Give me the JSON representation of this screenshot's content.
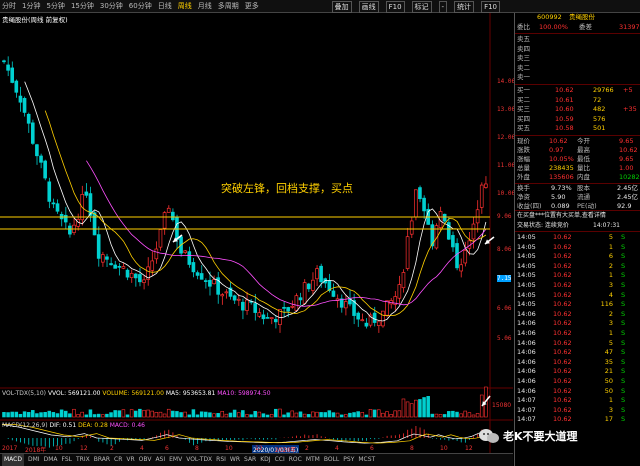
{
  "toolbar": {
    "tabs": [
      "分时",
      "1分钟",
      "5分钟",
      "15分钟",
      "30分钟",
      "60分钟",
      "日线",
      "周线",
      "月线",
      "多周期",
      "更多"
    ],
    "active_tab": "周线",
    "tools": [
      "叠加",
      "画线",
      "F10",
      "标记",
      "-",
      "统计",
      "F10"
    ]
  },
  "chart": {
    "title": "贵绳股份(周线 前复权)",
    "annotation": "突破左锋，回档支撑，买点",
    "price_labels": [
      "14.06",
      "13.06",
      "12.06",
      "11.06",
      "10.06",
      "9.06",
      "8.06",
      "7.15",
      "6.06",
      "5.06",
      "4.06",
      "3.06",
      "2.06"
    ],
    "date_labels": [
      "2017",
      "2018年",
      "10",
      "12",
      "2",
      "4",
      "6",
      "8",
      "10",
      "12",
      "2020年",
      "2",
      "4",
      "6",
      "8",
      "10",
      "12"
    ],
    "volume_header": {
      "label": "VOL-TDX(5,10)",
      "vvol": "VVOL: 569121.00",
      "volume": "VOLUME: 569121.00",
      "ma5": "MA5: 953653.81",
      "ma10": "MA10: 598974.50"
    },
    "volume_axis_label": "15080",
    "macd_header": {
      "label": "MACD(12,26,9)",
      "dif": "DIF: 0.51",
      "dea": "DEA: 0.28",
      "macd": "MACD: 0.46"
    },
    "date_marker": "2020/01/03(五)",
    "colors": {
      "up": "#ff3030",
      "down": "#00d0d0",
      "vol_up": "#ff3030",
      "vol_down": "#00d0d0"
    }
  },
  "bottom_tabs": [
    "MACD",
    "DMI",
    "DMA",
    "FSL",
    "TRIX",
    "BRAR",
    "CR",
    "VR",
    "OBV",
    "ASI",
    "EMV",
    "VOL-TDX",
    "RSI",
    "WR",
    "SAR",
    "KDJ",
    "CCI",
    "ROC",
    "MTM",
    "BOLL",
    "PSY",
    "MCST"
  ],
  "bottom_active": "MACD",
  "panel": {
    "code": "600992",
    "name": "贵绳股份",
    "weibi_label": "委比",
    "weibi_value": "100.00%",
    "weicha_label": "委差",
    "weicha_value": "31397",
    "sell_levels": [
      {
        "label": "卖五",
        "price": "",
        "vol": ""
      },
      {
        "label": "卖四",
        "price": "",
        "vol": ""
      },
      {
        "label": "卖三",
        "price": "",
        "vol": ""
      },
      {
        "label": "卖二",
        "price": "",
        "vol": ""
      },
      {
        "label": "卖一",
        "price": "",
        "vol": ""
      }
    ],
    "buy_levels": [
      {
        "label": "买一",
        "price": "10.62",
        "vol": "29766",
        "chg": "+5"
      },
      {
        "label": "买二",
        "price": "10.61",
        "vol": "72",
        "chg": ""
      },
      {
        "label": "买三",
        "price": "10.60",
        "vol": "482",
        "chg": "+35"
      },
      {
        "label": "买四",
        "price": "10.59",
        "vol": "576",
        "chg": ""
      },
      {
        "label": "买五",
        "price": "10.58",
        "vol": "501",
        "chg": ""
      }
    ],
    "stats": [
      {
        "l1": "现价",
        "v1": "10.62",
        "l2": "今开",
        "v2": "9.65"
      },
      {
        "l1": "涨跌",
        "v1": "0.97",
        "l2": "最高",
        "v2": "10.62"
      },
      {
        "l1": "涨幅",
        "v1": "10.05%",
        "l2": "最低",
        "v2": "9.65"
      },
      {
        "l1": "总量",
        "v1": "238435",
        "l2": "量比",
        "v2": "1.00"
      },
      {
        "l1": "外盘",
        "v1": "135606",
        "l2": "内盘",
        "v2": "102829"
      }
    ],
    "stats2": [
      {
        "l1": "换手",
        "v1": "9.73%",
        "l2": "股本",
        "v2": "2.45亿"
      },
      {
        "l1": "净资",
        "v1": "5.90",
        "l2": "流通",
        "v2": "2.45亿"
      },
      {
        "l1": "收益(四)",
        "v1": "0.089",
        "l2": "PE(动)",
        "v2": "92.9"
      }
    ],
    "notice": "在买盘***位置有大买单,查看详情",
    "trade_status_label": "交易状态: 连续竞价",
    "trade_time": "14:07:31",
    "ticks": [
      {
        "t": "14:05",
        "p": "10.62",
        "v": "5",
        "d": "S"
      },
      {
        "t": "14:05",
        "p": "10.62",
        "v": "1",
        "d": "S"
      },
      {
        "t": "14:05",
        "p": "10.62",
        "v": "6",
        "d": "S"
      },
      {
        "t": "14:05",
        "p": "10.62",
        "v": "2",
        "d": "S"
      },
      {
        "t": "14:05",
        "p": "10.62",
        "v": "1",
        "d": "S"
      },
      {
        "t": "14:05",
        "p": "10.62",
        "v": "3",
        "d": "S"
      },
      {
        "t": "14:05",
        "p": "10.62",
        "v": "4",
        "d": "S"
      },
      {
        "t": "14:05",
        "p": "10.62",
        "v": "116",
        "d": "S"
      },
      {
        "t": "14:06",
        "p": "10.62",
        "v": "2",
        "d": "S"
      },
      {
        "t": "14:06",
        "p": "10.62",
        "v": "3",
        "d": "S"
      },
      {
        "t": "14:06",
        "p": "10.62",
        "v": "1",
        "d": "S"
      },
      {
        "t": "14:06",
        "p": "10.62",
        "v": "5",
        "d": "S"
      },
      {
        "t": "14:06",
        "p": "10.62",
        "v": "47",
        "d": "S"
      },
      {
        "t": "14:06",
        "p": "10.62",
        "v": "35",
        "d": "S"
      },
      {
        "t": "14:06",
        "p": "10.62",
        "v": "21",
        "d": "S"
      },
      {
        "t": "14:06",
        "p": "10.62",
        "v": "50",
        "d": "S"
      },
      {
        "t": "14:06",
        "p": "10.62",
        "v": "50",
        "d": "S"
      },
      {
        "t": "14:07",
        "p": "10.62",
        "v": "1",
        "d": "S"
      },
      {
        "t": "14:07",
        "p": "10.62",
        "v": "3",
        "d": "S"
      },
      {
        "t": "14:07",
        "p": "10.62",
        "v": "17",
        "d": "S"
      }
    ]
  },
  "watermark": "老K不要大道理"
}
